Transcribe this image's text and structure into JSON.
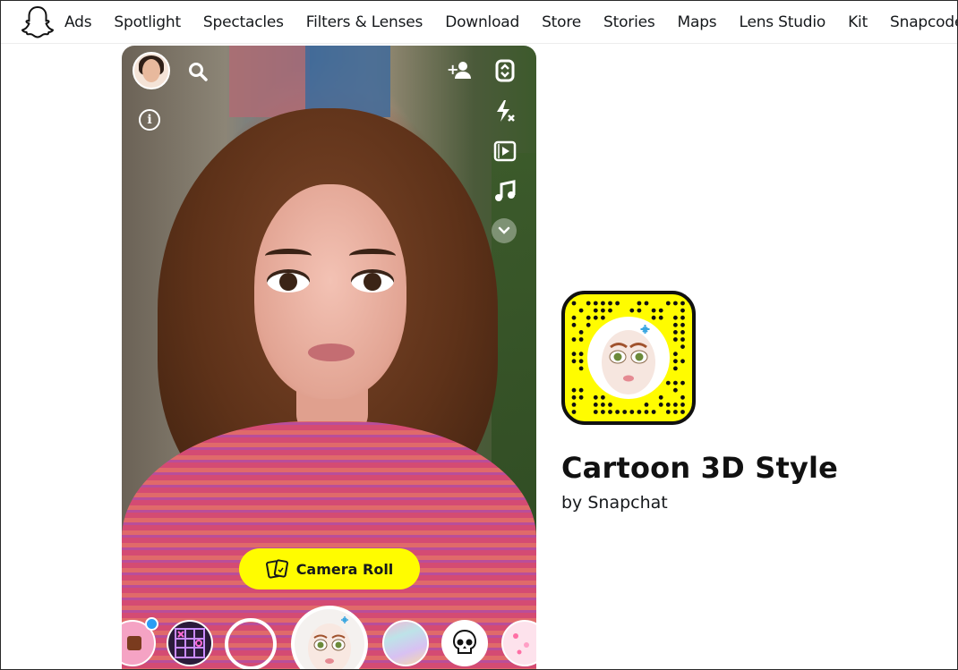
{
  "nav": {
    "items": [
      {
        "label": "Ads"
      },
      {
        "label": "Spotlight"
      },
      {
        "label": "Spectacles"
      },
      {
        "label": "Filters & Lenses"
      },
      {
        "label": "Download"
      },
      {
        "label": "Store"
      },
      {
        "label": "Stories"
      },
      {
        "label": "Maps"
      },
      {
        "label": "Lens Studio"
      },
      {
        "label": "Kit"
      },
      {
        "label": "Snapcode"
      }
    ]
  },
  "camera": {
    "camera_roll_label": "Camera Roll",
    "icons": {
      "search": "search-icon",
      "add_friend": "add-friend-icon",
      "flip": "flip-camera-icon",
      "flash": "flash-off-icon",
      "video": "video-clip-icon",
      "music": "music-icon",
      "more": "chevron-down-icon",
      "info": "info-icon"
    }
  },
  "lens": {
    "title": "Cartoon 3D Style",
    "author": "by Snapchat"
  },
  "colors": {
    "snap_yellow": "#fffc00",
    "text": "#16191c"
  }
}
